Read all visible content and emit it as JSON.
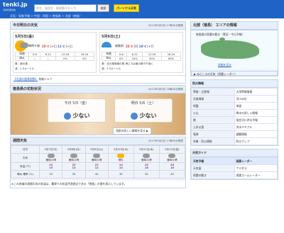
{
  "header": {
    "logo": "tenki.jp",
    "logo_sub": "日本気象協会",
    "search_placeholder": "地名・施設名・郵便番号を入力",
    "search_button": "検索",
    "personal_button": "パーソナル天気",
    "breadcrumb": "天気・気象予報 > 中国・四国 > 徳島県 > 北部（徳島）"
  },
  "today": {
    "title": "今日明日の天気",
    "meta": "2017年5月5日 17時00分発表",
    "days": [
      {
        "title": "5月5日(金)",
        "weather": "晴時々曇",
        "high": "25℃",
        "high_diff": "[+1]",
        "low": "11℃",
        "low_diff": "[+1]",
        "labels": [
          "時間",
          "降水"
        ],
        "slots": [
          "0-6",
          "6-12",
          "12-18",
          "18-24"
        ],
        "rain": [
          "---",
          "---",
          "0%",
          "0%"
        ],
        "wind": "風：南の風",
        "wave": "波：1.5メートル"
      },
      {
        "title": "5月6日(土)",
        "weather": "曇後雨",
        "high": "25℃",
        "high_diff": "[0]",
        "low": "18℃",
        "low_diff": "[+7]",
        "labels": [
          "時間",
          "降水"
        ],
        "slots": [
          "0-6",
          "6-12",
          "12-18",
          "18-24"
        ],
        "rain": [
          "0%",
          "10%",
          "50%",
          "60%"
        ],
        "wind": "風：北の風後南の風 海上では南の風やや強く",
        "wave": "波：1.5メートル"
      }
    ],
    "link": "【北部の服装指数】",
    "link_value": "長袖シャツ"
  },
  "pollen": {
    "title": "徳島県の花粉状況",
    "meta": "2017年5月5日 16時00分発表",
    "today_date": "今日 5/5（金）",
    "today_level": "少ない",
    "tomorrow_date": "明日 5/6（土）",
    "tomorrow_level": "少ない",
    "more": "花粉の詳しい情報を見る ▶"
  },
  "weekly": {
    "title": "週間天気",
    "meta": "2017年5月5日 17時00分発表",
    "dates": [
      "5月7日(日)",
      "5月8日(月)",
      "5月9日(火)",
      "5月10日(水)",
      "5月11日(木)",
      "5月12日(金)"
    ],
    "labels": [
      "日付",
      "天気",
      "気温\n(℃)",
      "降水\n確率\n(%)"
    ],
    "weather": [
      "曇時々晴",
      "曇時々晴",
      "曇時々晴",
      "晴れ",
      "曇時々晴",
      "曇時々晴"
    ],
    "high": [
      "24",
      "25",
      "23",
      "24",
      "25",
      "26"
    ],
    "low": [
      "15",
      "13",
      "12",
      "14",
      "16",
      "16"
    ],
    "rain": [
      "20",
      "30",
      "40",
      "30",
      "40",
      "40"
    ],
    "note": "※この地域の週間天気の気温は、最寄りの気温予測地点である「徳島」の値を表示しています。"
  },
  "area": {
    "title": "北部（徳島） エリアの情報",
    "caption": "徳島県の雨雲の動き（実況・今日予報）",
    "map_link": "詳細を見る",
    "rainlink": "▶ みどころの天気（雨雲レーダー）"
  },
  "disaster": {
    "header": "防災情報",
    "items": [
      [
        "警報・注意報",
        "大雨警報情報"
      ],
      [
        "台風情報",
        "河川水位"
      ],
      [
        "地震",
        "津波"
      ],
      [
        "火山",
        "降水の詳しい情報"
      ],
      [
        "雷",
        "指定河川洪水予報"
      ],
      [
        "土砂災害",
        "洪水キキクル"
      ],
      [
        "竜巻",
        "避難情報"
      ],
      [
        "気象・防災情報",
        "防災マップ"
      ]
    ]
  },
  "guide": {
    "header": "天気ガイド",
    "items": [
      [
        "天気予報",
        "雨雲レーダー"
      ],
      [
        "天気図",
        "アメダス"
      ],
      [
        "雨雲の動き",
        "雨雲ズームレーダー"
      ]
    ]
  }
}
